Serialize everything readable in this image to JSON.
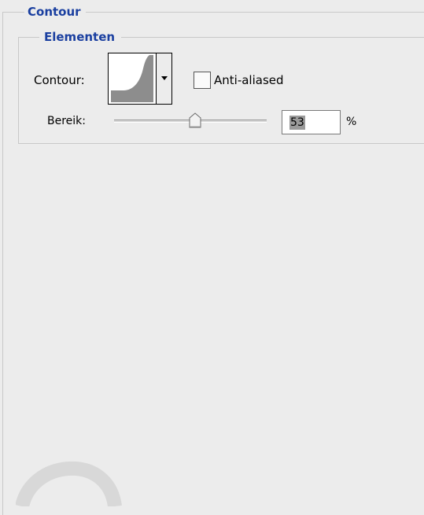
{
  "sections": {
    "outer_title": "Contour",
    "inner_title": "Elementen"
  },
  "contour": {
    "label": "Contour:",
    "preview_icon": "contour-curve-icon",
    "dropdown_icon": "triangle-down-icon"
  },
  "anti_aliased": {
    "label": "Anti-aliased",
    "checked": false
  },
  "range": {
    "label": "Bereik:",
    "value": "53",
    "unit": "%",
    "slider_percent": 53
  },
  "colors": {
    "title": "#1a3fa0",
    "panel_bg": "#ececec"
  }
}
